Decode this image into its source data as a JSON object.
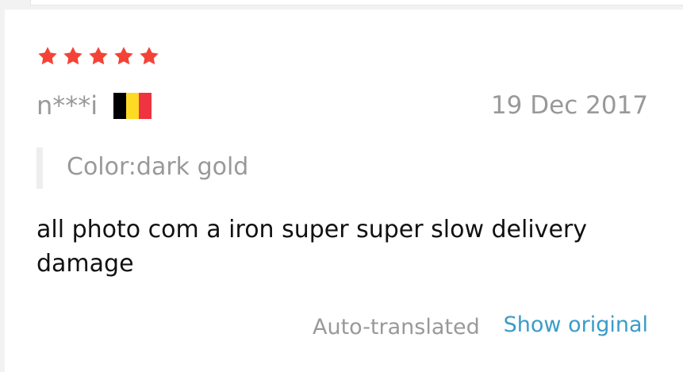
{
  "review": {
    "rating": 5,
    "rating_max": 5,
    "star_color": "#f44336",
    "user_name": "n***i",
    "country_flag": "belgium-flag",
    "flag_colors": [
      "#000000",
      "#fdda24",
      "#ef3340"
    ],
    "date": "19 Dec 2017",
    "sku_label": "Color:dark gold",
    "text": "all photo com a iron super super slow delivery damage",
    "auto_translated_label": "Auto-translated",
    "show_original_label": "Show original",
    "link_color": "#3a9cc8"
  }
}
